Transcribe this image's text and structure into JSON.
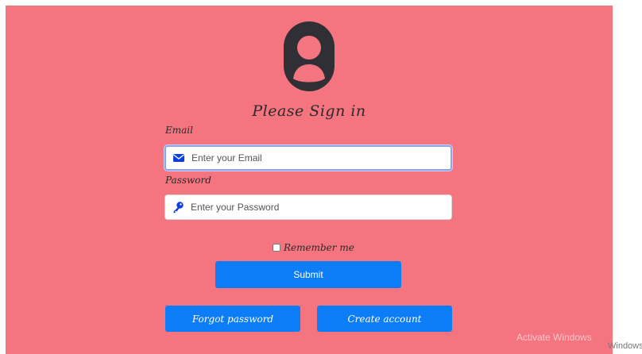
{
  "form": {
    "title": "Please Sign in",
    "email": {
      "label": "Email",
      "placeholder": "Enter your Email",
      "icon": "envelope-icon"
    },
    "password": {
      "label": "Password",
      "placeholder": "Enter your Password",
      "icon": "key-icon"
    },
    "remember_label": "Remember me",
    "submit_label": "Submit",
    "forgot_label": "Forgot password",
    "create_label": "Create account"
  },
  "watermark": {
    "line1": "Activate Windows",
    "tail": "Windows"
  },
  "colors": {
    "background": "#f4747f",
    "button": "#0d7cf7",
    "avatar": "#2f2f35"
  }
}
